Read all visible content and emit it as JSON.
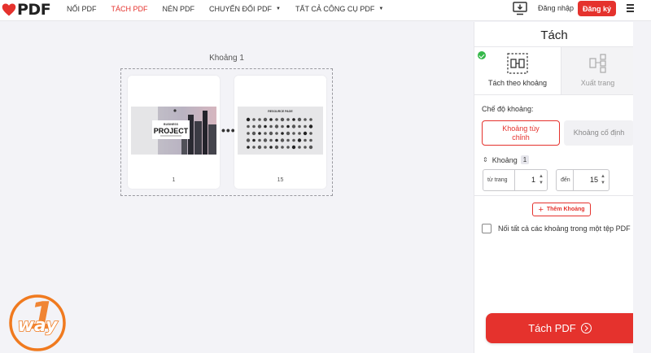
{
  "brand": {
    "logo_text": "PDF",
    "accent": "#e5322d"
  },
  "nav": {
    "items": [
      {
        "label": "NỐI PDF",
        "active": false,
        "dropdown": false
      },
      {
        "label": "TÁCH PDF",
        "active": true,
        "dropdown": false
      },
      {
        "label": "NÉN PDF",
        "active": false,
        "dropdown": false
      },
      {
        "label": "CHUYỂN ĐỔI PDF",
        "active": false,
        "dropdown": true
      },
      {
        "label": "TẤT CẢ CÔNG CỤ PDF",
        "active": false,
        "dropdown": true
      }
    ],
    "login": "Đăng nhập",
    "signup": "Đăng ký",
    "icons": [
      "desktop-download-icon",
      "hamburger-menu-icon"
    ]
  },
  "workspace": {
    "range_label": "Khoảng 1",
    "pages": [
      {
        "number": "1",
        "thumb_title": "PROJECT",
        "thumb_kicker": "BUSINESS"
      },
      {
        "number": "15",
        "thumb_title": "RESOURCE PAGE"
      }
    ],
    "ellipsis": "•••"
  },
  "sidebar": {
    "title": "Tách",
    "tabs": [
      {
        "label": "Tách theo khoảng",
        "active": true
      },
      {
        "label": "Xuất trang",
        "active": false
      }
    ],
    "mode_label": "Chế độ khoảng:",
    "options": [
      {
        "label": "Khoảng tùy chỉnh",
        "selected": true
      },
      {
        "label": "Khoảng cố định",
        "selected": false
      }
    ],
    "range": {
      "title": "Khoảng",
      "count": "1",
      "from_label": "từ trang",
      "from_value": "1",
      "to_label": "đến",
      "to_value": "15"
    },
    "add_range": "Thêm Khoảng",
    "merge_label": "Nối tất cả các khoảng trong một tệp PDF",
    "merge_checked": false,
    "submit": "Tách PDF"
  }
}
